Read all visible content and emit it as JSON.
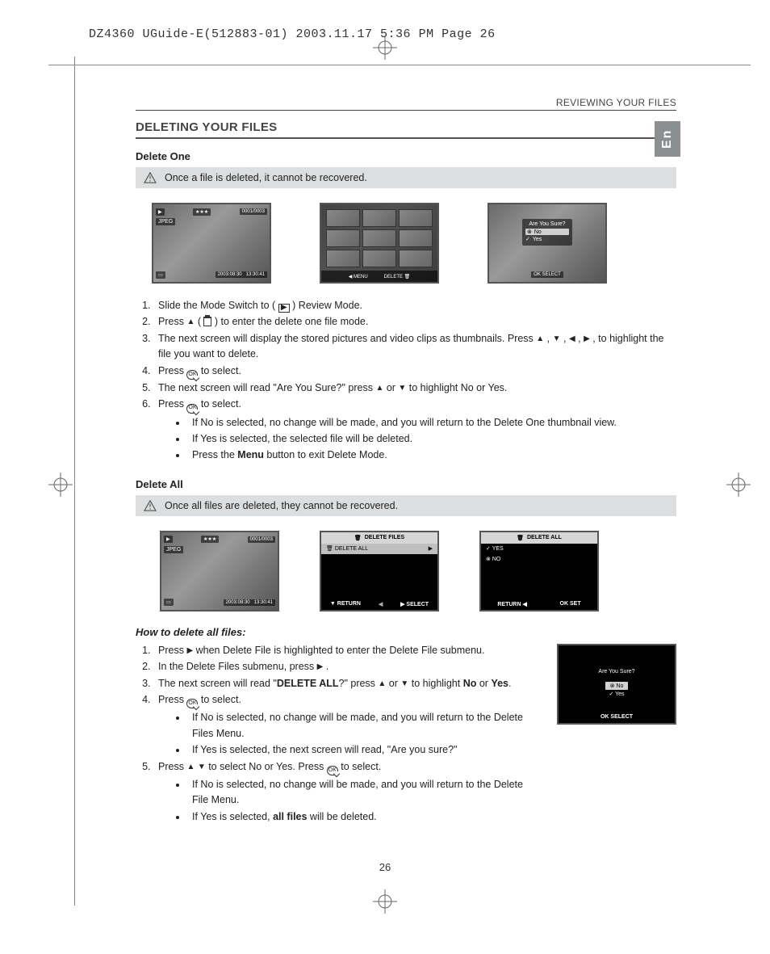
{
  "print_header": "DZ4360 UGuide-E(512883-01)  2003.11.17  5:36 PM  Page 26",
  "breadcrumb": "REVIEWING YOUR FILES",
  "language_tab": "En",
  "page_number": "26",
  "section1": {
    "title": "DELETING YOUR FILES",
    "subhead": "Delete One",
    "warning": "Once a file is deleted, it cannot be recovered.",
    "screens": {
      "a": {
        "format": "JPEG",
        "counter": "0001/0003",
        "date": "2003:08:30",
        "time": "13:30:41",
        "play_icon": "▶",
        "stars": "★★★"
      },
      "b": {
        "menu_left": "◀ MENU",
        "menu_right": "DELETE"
      },
      "c": {
        "question": "Are You Sure?",
        "no": "No",
        "yes": "Yes",
        "select": "SELECT"
      }
    },
    "steps": {
      "s1a": "Slide the Mode Switch to ( ",
      "s1b": " ) Review Mode.",
      "s2a": "Press ",
      "s2b": " ( ",
      "s2c": " ) to enter the delete one file mode.",
      "s3a": "The next screen will display the stored pictures and video clips as thumbnails. Press ",
      "s3b": " , ",
      "s3c": " , ",
      "s3d": " , ",
      "s3e": " , to highlight the file you want to delete.",
      "s4a": "Press ",
      "s4b": " to select.",
      "s5a": "The next screen will read \"Are You Sure?\" press ",
      "s5b": " or ",
      "s5c": " to highlight No or Yes.",
      "s6a": "Press ",
      "s6b": " to select.",
      "b1": "If No is selected, no change will be made, and you will return to the Delete One thumbnail view.",
      "b2": "If Yes is selected, the selected file will be deleted.",
      "b3a": "Press the ",
      "b3b": "Menu",
      "b3c": " button to exit Delete Mode."
    }
  },
  "section2": {
    "subhead": "Delete All",
    "warning": "Once all files are deleted, they cannot be recovered.",
    "screens": {
      "a": {
        "format": "JPEG",
        "counter": "0001/0003",
        "date": "2003:08:30",
        "time": "13:30:41"
      },
      "b": {
        "title": "DELETE FILES",
        "row": "DELETE ALL",
        "return": "RETURN",
        "select": "SELECT"
      },
      "c": {
        "title": "DELETE ALL",
        "yes": "YES",
        "no": "NO",
        "return": "RETURN",
        "set": "SET"
      },
      "d": {
        "question": "Are You Sure?",
        "no": "No",
        "yes": "Yes",
        "select": "SELECT"
      }
    },
    "howto": "How to delete all files:",
    "steps": {
      "s1a": "Press ",
      "s1b": " when Delete File is highlighted to enter the Delete File submenu.",
      "s2a": "In the Delete Files submenu, press ",
      "s2b": " .",
      "s3a": "The next screen will read \"",
      "s3b": "DELETE ALL",
      "s3c": "?\" press ",
      "s3d": " or ",
      "s3e": " to highlight ",
      "s3f": "No",
      "s3g": " or ",
      "s3h": "Yes",
      "s3i": ".",
      "s4a": "Press ",
      "s4b": " to select.",
      "b1": "If No is selected, no change will be made, and you will return to the Delete Files Menu.",
      "b2": "If Yes is selected, the next screen will read, \"Are you sure?\"",
      "s5a": "Press ",
      "s5b": " to select No or Yes. Press ",
      "s5c": " to select.",
      "b3": "If No is selected, no change will be made, and you will return to the Delete File Menu.",
      "b4a": "If Yes is selected, ",
      "b4b": "all files",
      "b4c": " will be deleted."
    }
  }
}
